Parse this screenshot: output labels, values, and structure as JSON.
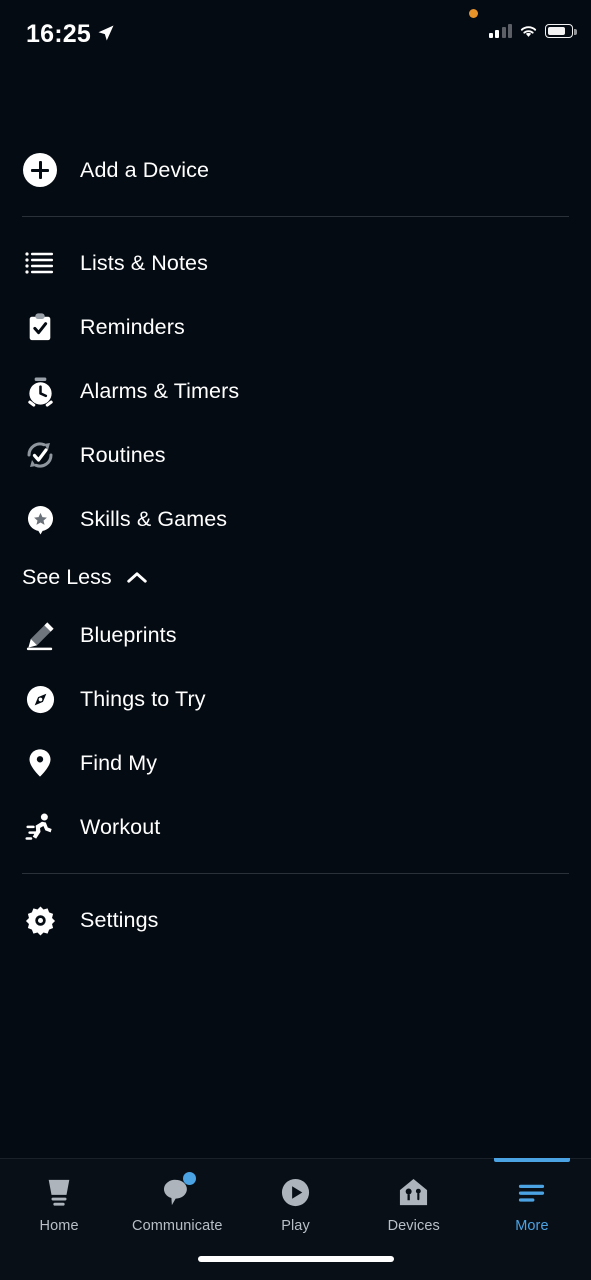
{
  "status_bar": {
    "time": "16:25",
    "location_icon": "location-arrow-icon",
    "privacy_dot": "orange-recording-dot",
    "cellular_icon": "cellular-signal-icon",
    "cellular_bars_filled": 2,
    "cellular_bars_total": 4,
    "wifi_icon": "wifi-icon",
    "battery_icon": "battery-icon",
    "battery_level_percent": 68,
    "colors": {
      "privacy_dot": "#E8922A",
      "foreground": "#FFFFFF"
    }
  },
  "menu": {
    "add_device": {
      "label": "Add a Device",
      "icon": "plus-circle-icon"
    },
    "primary_items": [
      {
        "label": "Lists & Notes",
        "icon": "list-lines-icon"
      },
      {
        "label": "Reminders",
        "icon": "clipboard-check-icon"
      },
      {
        "label": "Alarms & Timers",
        "icon": "alarm-clock-icon"
      },
      {
        "label": "Routines",
        "icon": "refresh-check-icon"
      },
      {
        "label": "Skills & Games",
        "icon": "speech-bubble-star-icon"
      }
    ],
    "see_less": {
      "label": "See Less",
      "icon": "chevron-up-icon"
    },
    "secondary_items": [
      {
        "label": "Blueprints",
        "icon": "pencil-icon"
      },
      {
        "label": "Things to Try",
        "icon": "compass-icon"
      },
      {
        "label": "Find My",
        "icon": "map-pin-icon"
      },
      {
        "label": "Workout",
        "icon": "running-person-icon"
      }
    ],
    "settings": {
      "label": "Settings",
      "icon": "gear-icon"
    }
  },
  "tab_bar": {
    "active_tab": "More",
    "accent_color": "#4BA3E3",
    "inactive_color": "#B9BFC6",
    "tabs": [
      {
        "label": "Home",
        "icon": "echo-speaker-icon",
        "active": false,
        "badge": false
      },
      {
        "label": "Communicate",
        "icon": "speech-bubble-icon",
        "active": false,
        "badge": true
      },
      {
        "label": "Play",
        "icon": "play-circle-icon",
        "active": false,
        "badge": false
      },
      {
        "label": "Devices",
        "icon": "house-devices-icon",
        "active": false,
        "badge": false
      },
      {
        "label": "More",
        "icon": "hamburger-menu-icon",
        "active": true,
        "badge": false
      }
    ]
  },
  "home_indicator": "home-indicator-bar"
}
